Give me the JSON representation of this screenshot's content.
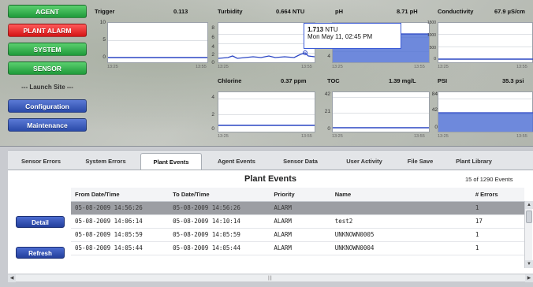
{
  "nav": {
    "agent": "AGENT",
    "plant_alarm": "PLANT ALARM",
    "system": "SYSTEM",
    "sensor": "SENSOR",
    "launch_site": "--- Launch Site ---",
    "configuration": "Configuration",
    "maintenance": "Maintenance"
  },
  "sensors": {
    "trigger": {
      "title": "Trigger",
      "value": "0.113",
      "yticks": [
        "10",
        "5",
        "0"
      ],
      "xticks": [
        "13:25",
        "13:55"
      ]
    },
    "turbidity": {
      "title": "Turbidity",
      "value": "0.664 NTU",
      "yticks": [
        "8",
        "6",
        "4",
        "2",
        "0"
      ],
      "xticks": [
        "13:25",
        "13:55"
      ]
    },
    "ph": {
      "title": "pH",
      "value": "8.71 pH",
      "yticks": [
        "8",
        "6",
        "4"
      ],
      "xticks": [
        "13:25",
        "13:55"
      ]
    },
    "conductivity": {
      "title": "Conductivity",
      "value": "67.9 µS/cm",
      "yticks": [
        "1500",
        "1000",
        "500",
        "0"
      ],
      "xticks": [
        "13:25",
        "13:55"
      ]
    },
    "chlorine": {
      "title": "Chlorine",
      "value": "0.37 ppm",
      "yticks": [
        "4",
        "2",
        "0"
      ],
      "xticks": [
        "13:25",
        "13:55"
      ]
    },
    "toc": {
      "title": "TOC",
      "value": "1.39 mg/L",
      "yticks": [
        "42",
        "21",
        "0"
      ],
      "xticks": [
        "13:25",
        "13:55"
      ]
    },
    "psi": {
      "title": "PSI",
      "value": "35.3 psi",
      "yticks": [
        "84",
        "42",
        "0"
      ],
      "xticks": [
        "13:25",
        "13:55"
      ]
    }
  },
  "tooltip": {
    "value": "1.713",
    "unit": "NTU",
    "timestamp": "Mon May 11, 02:45 PM"
  },
  "tabs": [
    "Sensor Errors",
    "System Errors",
    "Plant Events",
    "Agent Events",
    "Sensor Data",
    "User Activity",
    "File Save",
    "Plant Library"
  ],
  "active_tab": "Plant Events",
  "events": {
    "title": "Plant Events",
    "count_label": "15 of 1290 Events",
    "buttons": {
      "detail": "Detail",
      "refresh": "Refresh"
    },
    "columns": [
      "From Date/Time",
      "To Date/Time",
      "Priority",
      "Name",
      "# Errors"
    ],
    "rows": [
      [
        "05-08-2009 14:56:26",
        "05-08-2009 14:56:26",
        "ALARM",
        "",
        "1"
      ],
      [
        "05-08-2009 14:06:14",
        "05-08-2009 14:10:14",
        "ALARM",
        "test2",
        "17"
      ],
      [
        "05-08-2009 14:05:59",
        "05-08-2009 14:05:59",
        "ALARM",
        "UNKNOWN0005",
        "1"
      ],
      [
        "05-08-2009 14:05:44",
        "05-08-2009 14:05:44",
        "ALARM",
        "UNKNOWN0004",
        "1"
      ]
    ],
    "selected_row": 0
  },
  "colors": {
    "plot_line": "#2c47c4",
    "plot_fill": "#5574d6",
    "selected_row": "#9c9ea3"
  }
}
